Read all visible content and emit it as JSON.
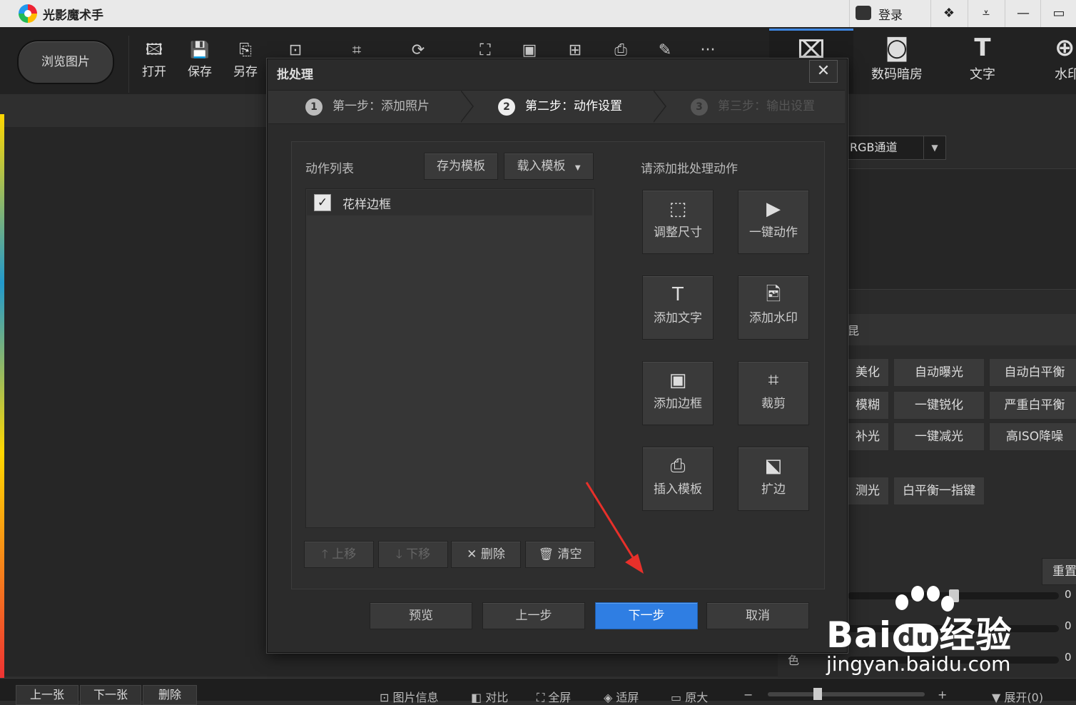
{
  "app": {
    "title": "光影魔术手",
    "login": "登录"
  },
  "toolbar": {
    "browse": "浏览图片",
    "open": "打开",
    "save": "保存",
    "save_as": "另存",
    "more": "···"
  },
  "right_tabs": [
    "数码暗房",
    "文字",
    "水印"
  ],
  "right_panel": {
    "channel": "RGB通道",
    "header_partial": "昆",
    "buttons": [
      [
        "美化",
        "自动曝光",
        "自动白平衡"
      ],
      [
        "模糊",
        "一键锐化",
        "严重白平衡"
      ],
      [
        "补光",
        "一键减光",
        "高ISO降噪"
      ],
      [
        "测光",
        "白平衡一指键"
      ]
    ],
    "reset": "重置",
    "slider_values": [
      "0",
      "0",
      "0"
    ],
    "color_label": "色"
  },
  "status_bar": {
    "prev": "上一张",
    "next": "下一张",
    "delete": "删除",
    "info": "图片信息",
    "compare": "对比",
    "fullscreen": "全屏",
    "fit": "适屏",
    "original": "原大",
    "minus": "−",
    "plus": "+",
    "expand": "展开(0)"
  },
  "dialog": {
    "title": "批处理",
    "steps": [
      {
        "num": "1",
        "label": "第一步：添加照片"
      },
      {
        "num": "2",
        "label": "第二步：动作设置"
      },
      {
        "num": "3",
        "label": "第三步：输出设置"
      }
    ],
    "action_list_label": "动作列表",
    "save_template": "存为模板",
    "load_template": "载入模板",
    "items": [
      {
        "checked": true,
        "label": "花样边框"
      }
    ],
    "list_buttons": {
      "up": "上移",
      "down": "下移",
      "delete": "删除",
      "clear": "清空"
    },
    "add_action_label": "请添加批处理动作",
    "actions": [
      "调整尺寸",
      "一键动作",
      "添加文字",
      "添加水印",
      "添加边框",
      "裁剪",
      "插入模板",
      "扩边"
    ],
    "footer": {
      "preview": "预览",
      "prev": "上一步",
      "next": "下一步",
      "cancel": "取消"
    }
  },
  "watermark": {
    "brand": "Bai",
    "brand2": "du",
    "brand_cn": "经验",
    "url": "jingyan.baidu.com"
  },
  "colors": {
    "accent": "#3f86e0",
    "next_button": "#2f7ee3",
    "arrow": "#e8302a"
  }
}
